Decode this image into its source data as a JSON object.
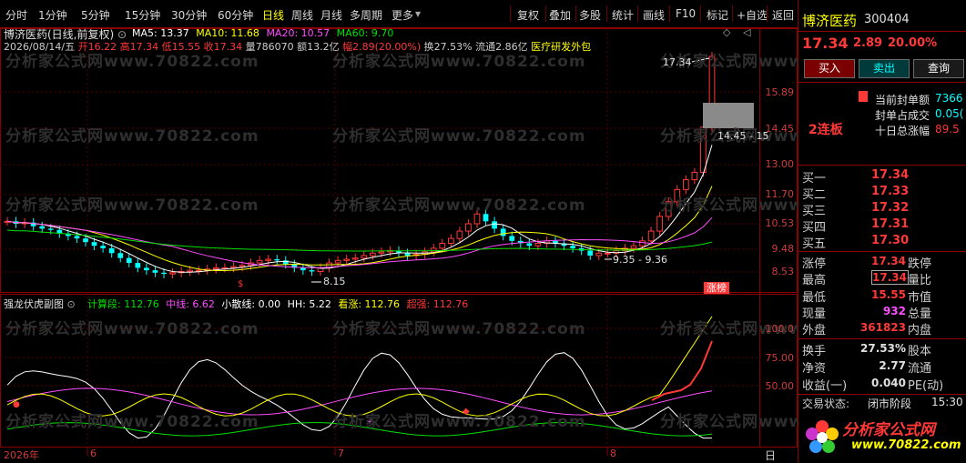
{
  "toolbar": {
    "periods": [
      "分时",
      "1分钟",
      "5分钟",
      "15分钟",
      "30分钟",
      "60分钟",
      "日线",
      "周线",
      "月线",
      "多周期",
      "更多"
    ],
    "active_period": "日线",
    "more_arrow": "▾",
    "tools": [
      "复权",
      "叠加",
      "多股",
      "统计",
      "画线",
      "F10",
      "标记",
      "+自选",
      "返回"
    ]
  },
  "main_chart": {
    "title": "博济医药(日线,前复权)",
    "mas": [
      {
        "label": "MA5: 13.37",
        "color": "#ffffff"
      },
      {
        "label": "MA10: 11.68",
        "color": "#ffff00"
      },
      {
        "label": "MA20: 10.57",
        "color": "#ff4dff"
      },
      {
        "label": "MA60: 9.70",
        "color": "#00e000"
      }
    ],
    "bar_info": {
      "date": "2026/08/14/五",
      "open": "开16.22",
      "high": "高17.34",
      "low": "低15.55",
      "close": "收17.34",
      "volume": "量786070",
      "amount": "额13.2亿",
      "change": "幅2.89(20.00%)",
      "turnover": "换27.53%",
      "float": "流通2.86亿",
      "sector": "医疗研发外包"
    },
    "price_axis": [
      "15.89",
      "14.45",
      "13.00",
      "11.70",
      "10.53",
      "9.48",
      "8.53"
    ],
    "annotations": {
      "high_label": "17.34",
      "box_label": "14.45 - 15",
      "low_label": "8.15",
      "range_label": "9.35 - 9.36",
      "badge": "涨榜"
    }
  },
  "sub_chart": {
    "title": "强龙伏虎副图",
    "indicators": [
      {
        "label": "计算段: 112.76",
        "color": "#00e000"
      },
      {
        "label": "中线: 6.62",
        "color": "#ff4dff"
      },
      {
        "label": "小散线: 0.00",
        "color": "#ffffff"
      },
      {
        "label": "HH: 5.22",
        "color": "#ffffff"
      },
      {
        "label": "看涨: 112.76",
        "color": "#ffff00"
      },
      {
        "label": "超强: 112.76",
        "color": "#ff3838"
      }
    ],
    "axis": [
      "100.0",
      "75.00",
      "50.00"
    ]
  },
  "time_axis": {
    "labels": [
      "2026年",
      "6",
      "7",
      "8"
    ],
    "corner": "日"
  },
  "watermark_text": "分析家公式网www.70822.com",
  "right_panel": {
    "stock_name": "博济医药",
    "stock_code": "300404",
    "price": "17.34",
    "change": "2.89",
    "change_pct": "20.00%",
    "buttons": [
      "买入",
      "卖出",
      "查询"
    ],
    "limit_board": "2连板",
    "seal_info": [
      {
        "label": "当前封单额",
        "value": "7366"
      },
      {
        "label": "封单占成交",
        "value": "0.05("
      },
      {
        "label": "十日总涨幅",
        "value": "89.5"
      }
    ],
    "order_book": [
      {
        "label": "买一",
        "value": "17.34"
      },
      {
        "label": "买二",
        "value": "17.33"
      },
      {
        "label": "买三",
        "value": "17.32"
      },
      {
        "label": "买四",
        "value": "17.31"
      },
      {
        "label": "买五",
        "value": "17.30"
      }
    ],
    "stats": [
      {
        "l1": "涨停",
        "v1": "17.34",
        "c1": "#ff3838",
        "l2": "跌停"
      },
      {
        "l1": "最高",
        "v1": "17.34",
        "c1": "#ff3838",
        "l2": "量比",
        "boxed": true
      },
      {
        "l1": "最低",
        "v1": "15.55",
        "c1": "#ff3838",
        "l2": "市值"
      },
      {
        "l1": "现量",
        "v1": "932",
        "c1": "#ff4dff",
        "l2": "总量"
      },
      {
        "l1": "外盘",
        "v1": "361823",
        "c1": "#ff3838",
        "l2": "内盘"
      }
    ],
    "stats2": [
      {
        "l1": "换手",
        "v1": "27.53%",
        "l2": "股本"
      },
      {
        "l1": "净资",
        "v1": "2.77",
        "l2": "流通"
      },
      {
        "l1": "收益(一)",
        "v1": "0.040",
        "l2": "PE(动)"
      }
    ],
    "trade_status_label": "交易状态:",
    "trade_status": "闭市阶段",
    "trade_time": "15:30",
    "logo_text": "分析家公式网",
    "logo_url": "www.70822.com"
  },
  "colors": {
    "up": "#ff3838",
    "down": "#00ffff",
    "border": "#8b0000",
    "accent": "#ffff00"
  }
}
